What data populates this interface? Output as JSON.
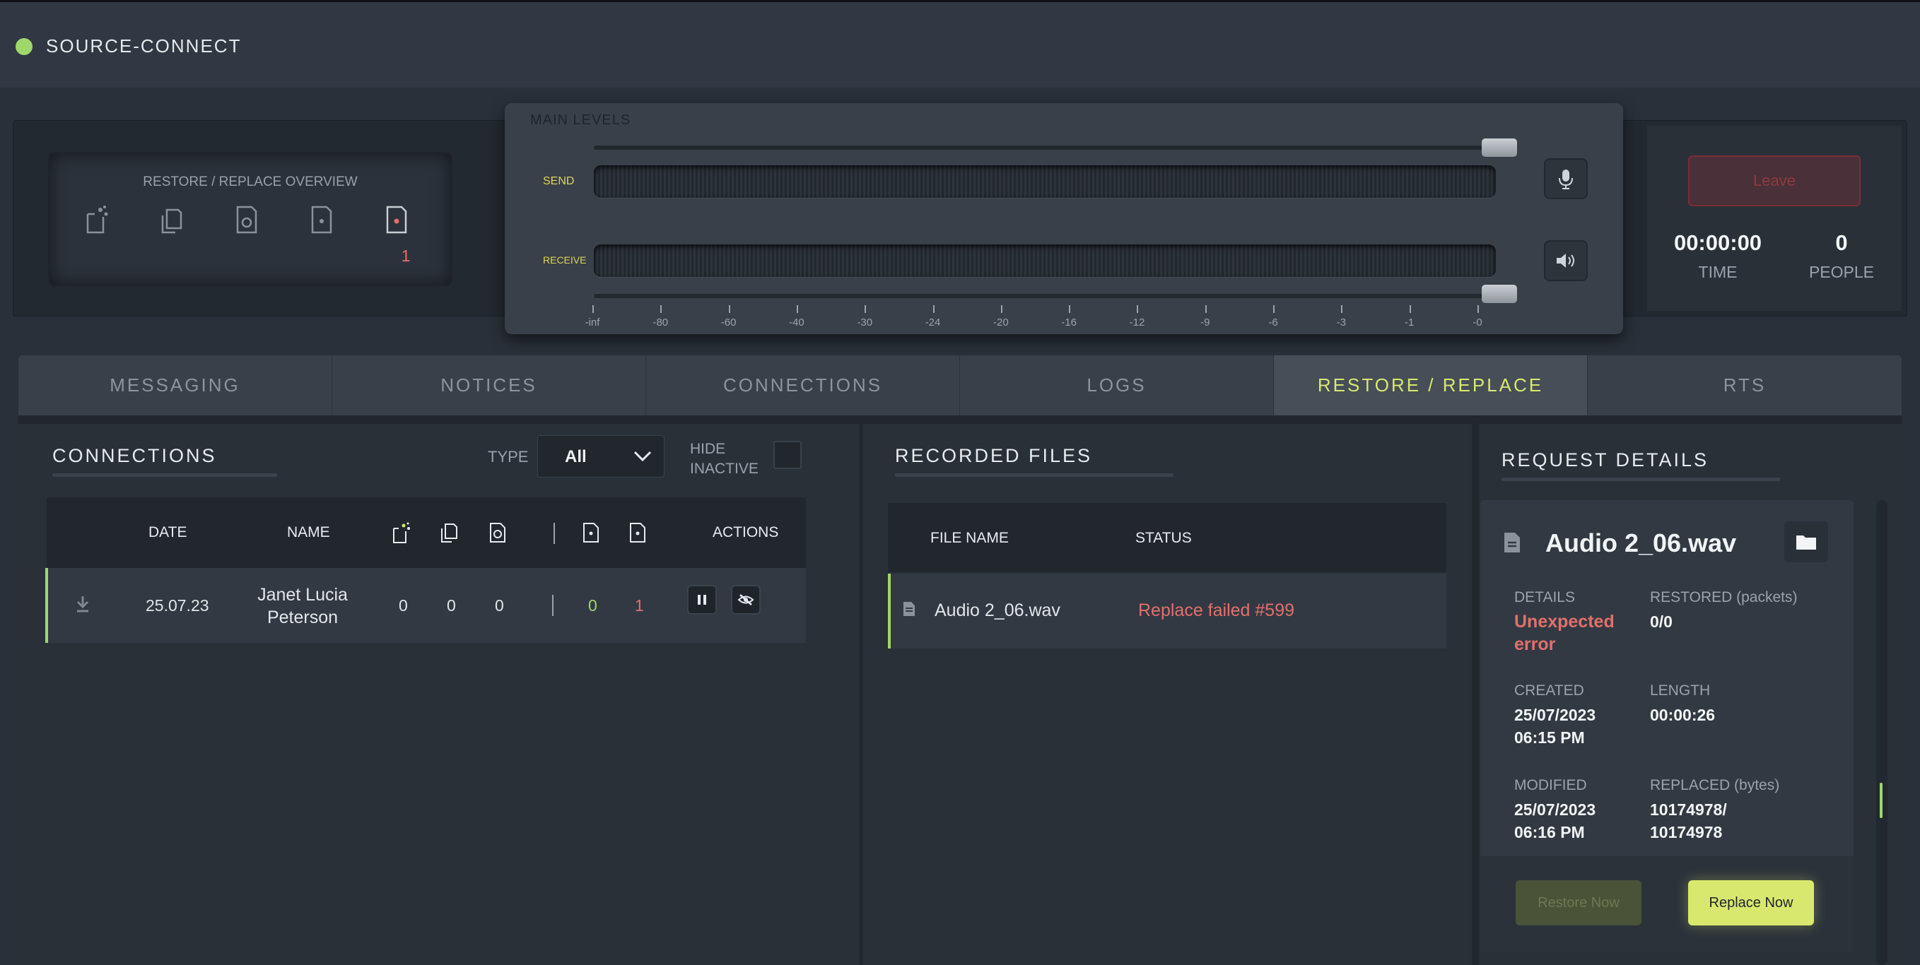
{
  "app": {
    "title": "SOURCE-CONNECT",
    "status_color": "#9fd86a"
  },
  "overview": {
    "title": "RESTORE / REPLACE OVERVIEW",
    "icons": [
      "file-sparkle-icon",
      "files-copy-icon",
      "file-record-icon",
      "file-dot-icon",
      "file-error-icon"
    ],
    "error_count": "1"
  },
  "levels": {
    "title": "MAIN LEVELS",
    "send_label": "SEND",
    "receive_label": "RECEIVE",
    "scale": [
      "-inf",
      "-80",
      "-60",
      "-40",
      "-30",
      "-24",
      "-20",
      "-16",
      "-12",
      "-9",
      "-6",
      "-3",
      "-1",
      "-0"
    ],
    "send_slider": 1.0,
    "receive_slider": 1.0,
    "mic_icon": "microphone-icon",
    "speaker_icon": "speaker-icon"
  },
  "session": {
    "leave_label": "Leave",
    "time_value": "00:00:00",
    "time_label": "TIME",
    "people_value": "0",
    "people_label": "PEOPLE"
  },
  "tabs": [
    {
      "label": "MESSAGING"
    },
    {
      "label": "NOTICES"
    },
    {
      "label": "CONNECTIONS"
    },
    {
      "label": "LOGS"
    },
    {
      "label": "RESTORE / REPLACE",
      "active": true
    },
    {
      "label": "RTS"
    }
  ],
  "connections": {
    "title": "CONNECTIONS",
    "type_label": "TYPE",
    "type_value": "All",
    "hide_inactive_label_1": "HIDE",
    "hide_inactive_label_2": "INACTIVE",
    "columns": {
      "date": "DATE",
      "name": "NAME",
      "actions": "ACTIONS"
    },
    "rows": [
      {
        "date": "25.07.23",
        "name_line1": "Janet Lucia",
        "name_line2": "Peterson",
        "c1": "0",
        "c2": "0",
        "c3": "0",
        "c4": "0",
        "c5": "1"
      }
    ]
  },
  "recorded": {
    "title": "RECORDED FILES",
    "col_file": "FILE NAME",
    "col_status": "STATUS",
    "rows": [
      {
        "file": "Audio 2_06.wav",
        "status": "Replace failed #599"
      }
    ]
  },
  "details": {
    "title": "REQUEST DETAILS",
    "filename": "Audio 2_06.wav",
    "details_label": "DETAILS",
    "details_value_1": "Unexpected",
    "details_value_2": "error",
    "restored_label": "RESTORED (packets)",
    "restored_value": "0/0",
    "created_label": "CREATED",
    "created_date": "25/07/2023",
    "created_time": "06:15 PM",
    "length_label": "LENGTH",
    "length_value": "00:00:26",
    "modified_label": "MODIFIED",
    "modified_date": "25/07/2023",
    "modified_time": "06:16 PM",
    "replaced_label": "REPLACED (bytes)",
    "replaced_value_1": "10174978/",
    "replaced_value_2": "10174978",
    "restore_btn": "Restore Now",
    "replace_btn": "Replace Now"
  },
  "colors": {
    "accent": "#d8e86e",
    "error": "#e2706a",
    "success": "#9fd86a",
    "background": "#2a3039"
  }
}
